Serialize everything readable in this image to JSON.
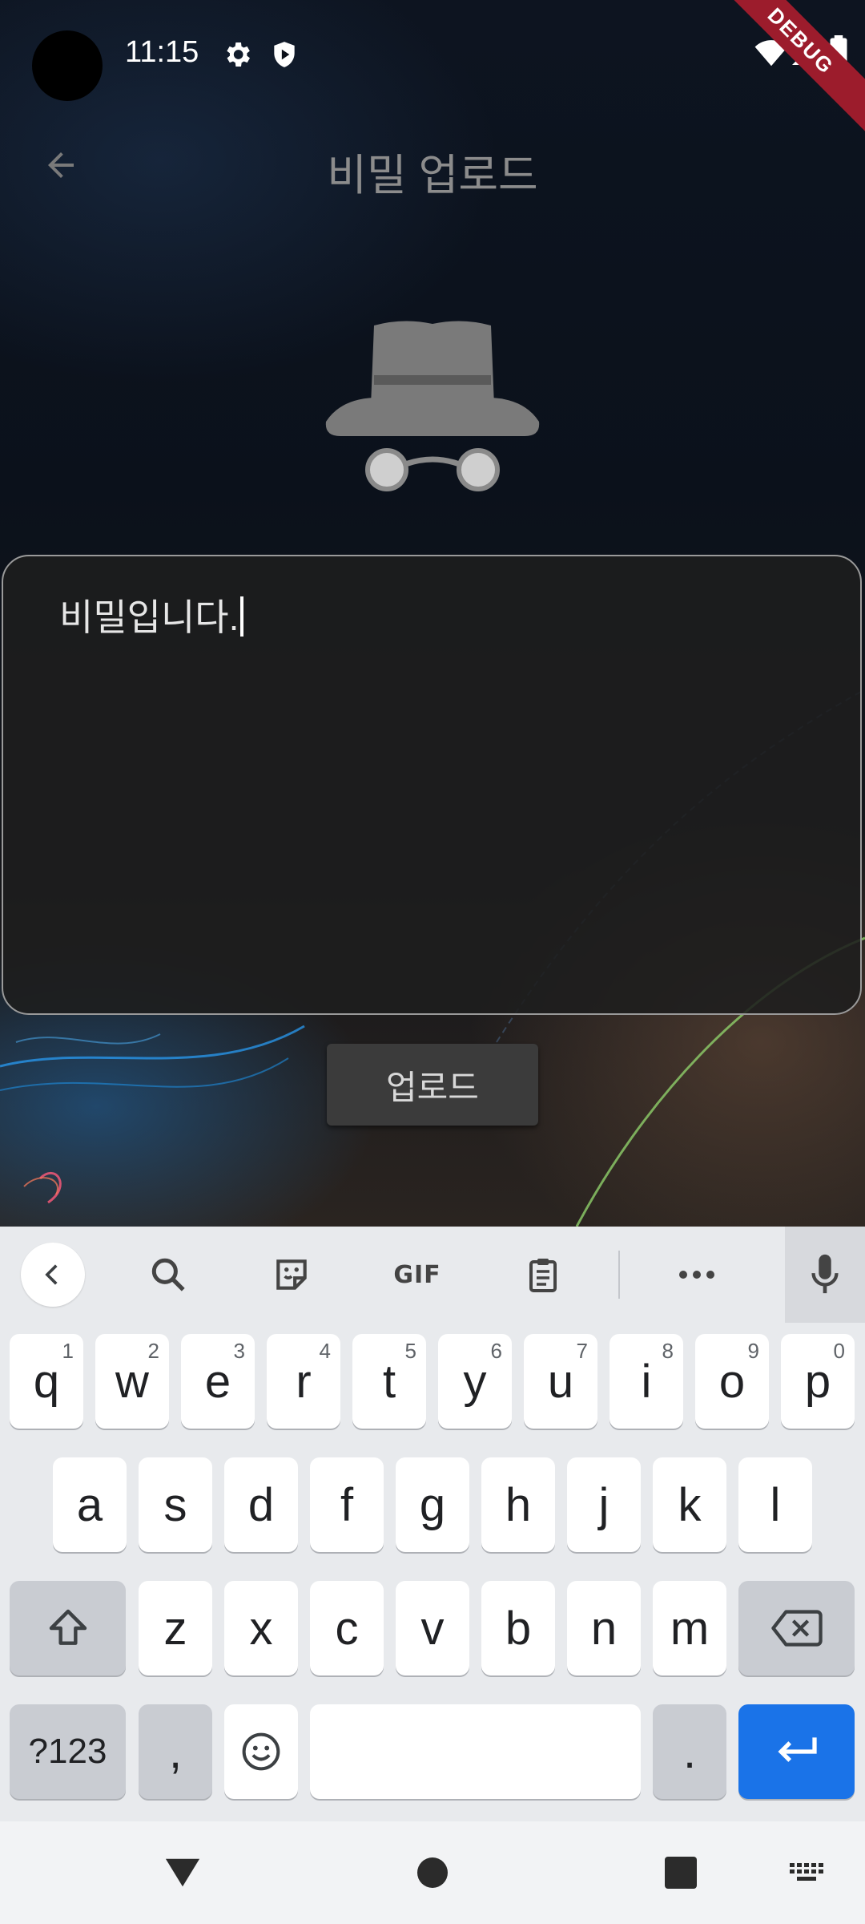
{
  "status_bar": {
    "time": "11:15",
    "debug_label": "DEBUG"
  },
  "app_bar": {
    "title": "비밀 업로드"
  },
  "editor": {
    "value": "비밀입니다."
  },
  "upload_button": {
    "label": "업로드"
  },
  "keyboard": {
    "toolbar": {
      "gif_label": "GIF"
    },
    "row1": [
      {
        "k": "q",
        "h": "1"
      },
      {
        "k": "w",
        "h": "2"
      },
      {
        "k": "e",
        "h": "3"
      },
      {
        "k": "r",
        "h": "4"
      },
      {
        "k": "t",
        "h": "5"
      },
      {
        "k": "y",
        "h": "6"
      },
      {
        "k": "u",
        "h": "7"
      },
      {
        "k": "i",
        "h": "8"
      },
      {
        "k": "o",
        "h": "9"
      },
      {
        "k": "p",
        "h": "0"
      }
    ],
    "row2": [
      "a",
      "s",
      "d",
      "f",
      "g",
      "h",
      "j",
      "k",
      "l"
    ],
    "row3": [
      "z",
      "x",
      "c",
      "v",
      "b",
      "n",
      "m"
    ],
    "symbols_label": "?123",
    "comma": ",",
    "period": "."
  },
  "colors": {
    "accent": "#1a73e8",
    "debug_banner": "#9c1c2c",
    "icon_gray": "#7a7a7a"
  }
}
